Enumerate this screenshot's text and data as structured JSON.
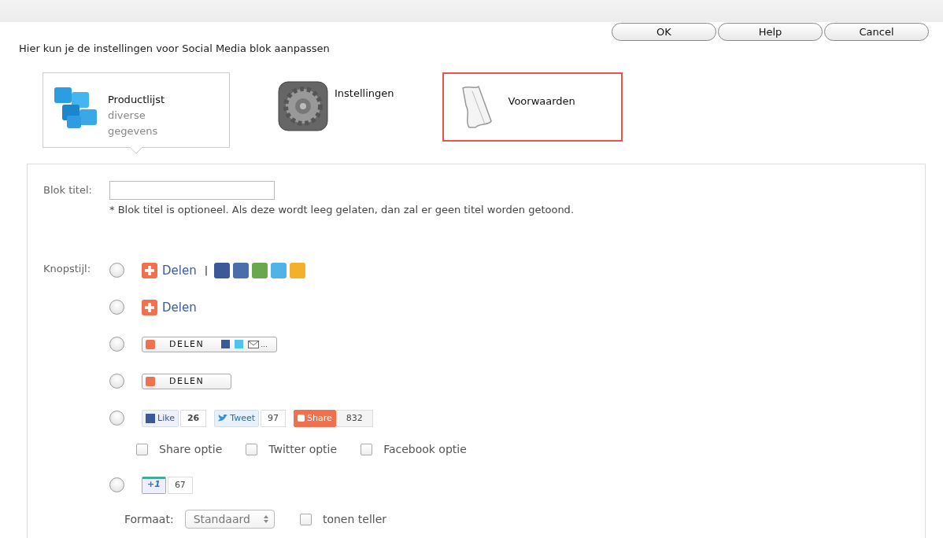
{
  "top_buttons": [
    {
      "label": "OK"
    },
    {
      "label": "Help"
    },
    {
      "label": "Cancel"
    }
  ],
  "description": "Hier kun je de instellingen voor Social Media blok aanpassen",
  "tabs": [
    {
      "kind": "cubes",
      "title": "Productlijst",
      "subtitle": "diverse gegevens",
      "selected": true,
      "highlighted": false
    },
    {
      "kind": "gear",
      "title": "Instellingen",
      "selected": false,
      "highlighted": false
    },
    {
      "kind": "scroll",
      "title": "Voorwaarden",
      "selected": false,
      "highlighted": true
    }
  ],
  "form": {
    "title_label": "Blok titel:",
    "title_note": "* Blok titel is optioneel. Als deze wordt leeg gelaten, dan zal er geen titel worden getoond.",
    "style_label": "Knopstijl:",
    "styles": [
      {
        "kind": "text_icons",
        "selected": false,
        "text": "Delen",
        "separator": "|"
      },
      {
        "kind": "text",
        "selected": false,
        "text": "Delen"
      },
      {
        "kind": "pill_icons",
        "selected": false,
        "text": "DELEN",
        "more": "..."
      },
      {
        "kind": "pill",
        "selected": false,
        "text": "DELEN"
      },
      {
        "kind": "counters",
        "selected": false,
        "like": "Like",
        "like_count": "26",
        "tweet": "Tweet",
        "tweet_count": "97",
        "share": "Share",
        "share_count": "832",
        "options": [
          {
            "label": "Share optie",
            "checked": false
          },
          {
            "label": "Twitter optie",
            "checked": false
          },
          {
            "label": "Facebook optie",
            "checked": false
          }
        ]
      },
      {
        "kind": "plusone",
        "selected": false,
        "text": "+1",
        "count": "67",
        "format_label": "Formaat:",
        "format_value": "Standaard",
        "counter": {
          "label": "tonen teller",
          "checked": false
        }
      }
    ]
  }
}
